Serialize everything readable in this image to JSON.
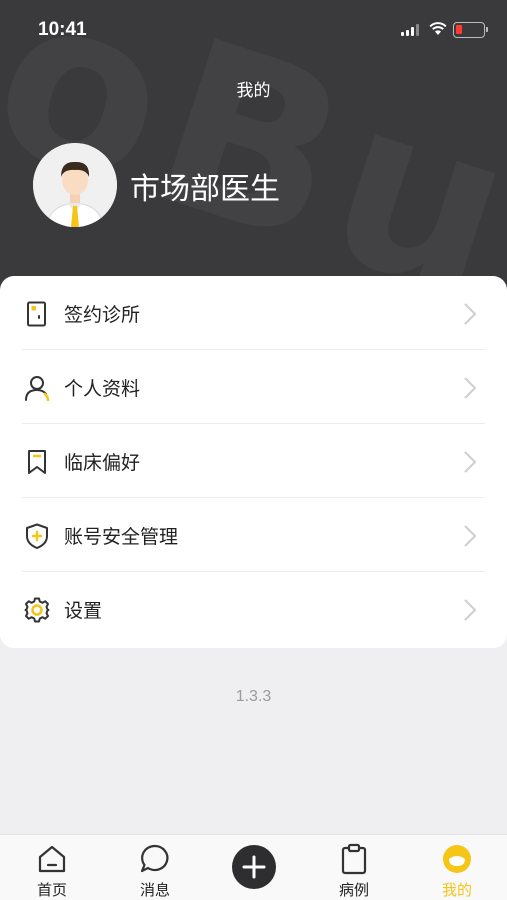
{
  "status_bar": {
    "time": "10:41",
    "battery_level": 0.15,
    "battery_color": "#ff3b30"
  },
  "header": {
    "title": "我的",
    "watermark": "oBull"
  },
  "profile": {
    "name": "市场部医生",
    "avatar_icon": "doctor-avatar-icon"
  },
  "menu": {
    "items": [
      {
        "label": "签约诊所",
        "icon": "clinic-door-icon"
      },
      {
        "label": "个人资料",
        "icon": "person-icon"
      },
      {
        "label": "临床偏好",
        "icon": "bookmark-icon"
      },
      {
        "label": "账号安全管理",
        "icon": "shield-plus-icon"
      },
      {
        "label": "设置",
        "icon": "gear-icon"
      }
    ]
  },
  "version": "1.3.3",
  "tabbar": {
    "items": [
      {
        "label": "首页",
        "icon": "home-icon"
      },
      {
        "label": "消息",
        "icon": "chat-bubble-icon"
      },
      {
        "label": "",
        "icon": "plus-icon"
      },
      {
        "label": "病例",
        "icon": "clipboard-icon"
      },
      {
        "label": "我的",
        "icon": "profile-face-icon",
        "active": true
      }
    ]
  },
  "colors": {
    "accent": "#f5c518",
    "header_bg": "#3a3a3c",
    "page_bg": "#efeff1"
  }
}
